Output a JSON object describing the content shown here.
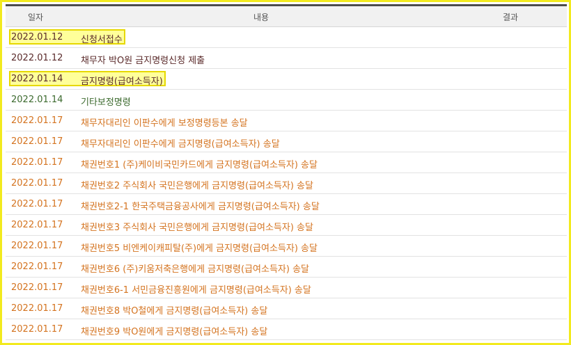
{
  "header": {
    "date": "일자",
    "content": "내용",
    "result": "결과"
  },
  "colors": {
    "frame": "#f2ea1e",
    "highlight_fill": "#ffff9a",
    "text_dark": "#5a2a2a",
    "text_green": "#3c6a2e",
    "text_orange": "#d4731f"
  },
  "rows": [
    {
      "date": "2022.01.12",
      "content": "신청서접수",
      "color": "dark",
      "highlighted": true
    },
    {
      "date": "2022.01.12",
      "content": "채무자 박O원 금지명령신청 제출",
      "color": "dark",
      "highlighted": false
    },
    {
      "date": "2022.01.14",
      "content": "금지명령(급여소득자)",
      "color": "dark",
      "highlighted": true
    },
    {
      "date": "2022.01.14",
      "content": "기타보정명령",
      "color": "green",
      "highlighted": false
    },
    {
      "date": "2022.01.17",
      "content": "채무자대리인 이판수에게 보정명령등본 송달",
      "color": "orange",
      "highlighted": false
    },
    {
      "date": "2022.01.17",
      "content": "채무자대리인 이판수에게 금지명령(급여소득자) 송달",
      "color": "orange",
      "highlighted": false
    },
    {
      "date": "2022.01.17",
      "content": "채권번호1 (주)케이비국민카드에게 금지명령(급여소득자) 송달",
      "color": "orange",
      "highlighted": false
    },
    {
      "date": "2022.01.17",
      "content": "채권번호2 주식회사 국민은행에게 금지명령(급여소득자) 송달",
      "color": "orange",
      "highlighted": false
    },
    {
      "date": "2022.01.17",
      "content": "채권번호2-1 한국주택금융공사에게 금지명령(급여소득자) 송달",
      "color": "orange",
      "highlighted": false
    },
    {
      "date": "2022.01.17",
      "content": "채권번호3 주식회사 국민은행에게 금지명령(급여소득자) 송달",
      "color": "orange",
      "highlighted": false
    },
    {
      "date": "2022.01.17",
      "content": "채권번호5 비엔케이캐피탈(주)에게 금지명령(급여소득자) 송달",
      "color": "orange",
      "highlighted": false
    },
    {
      "date": "2022.01.17",
      "content": "채권번호6 (주)키움저축은행에게 금지명령(급여소득자) 송달",
      "color": "orange",
      "highlighted": false
    },
    {
      "date": "2022.01.17",
      "content": "채권번호6-1 서민금융진흥원에게 금지명령(급여소득자) 송달",
      "color": "orange",
      "highlighted": false
    },
    {
      "date": "2022.01.17",
      "content": "채권번호8 박O철에게 금지명령(급여소득자) 송달",
      "color": "orange",
      "highlighted": false
    },
    {
      "date": "2022.01.17",
      "content": "채권번호9 박O원에게 금지명령(급여소득자) 송달",
      "color": "orange",
      "highlighted": false
    }
  ]
}
